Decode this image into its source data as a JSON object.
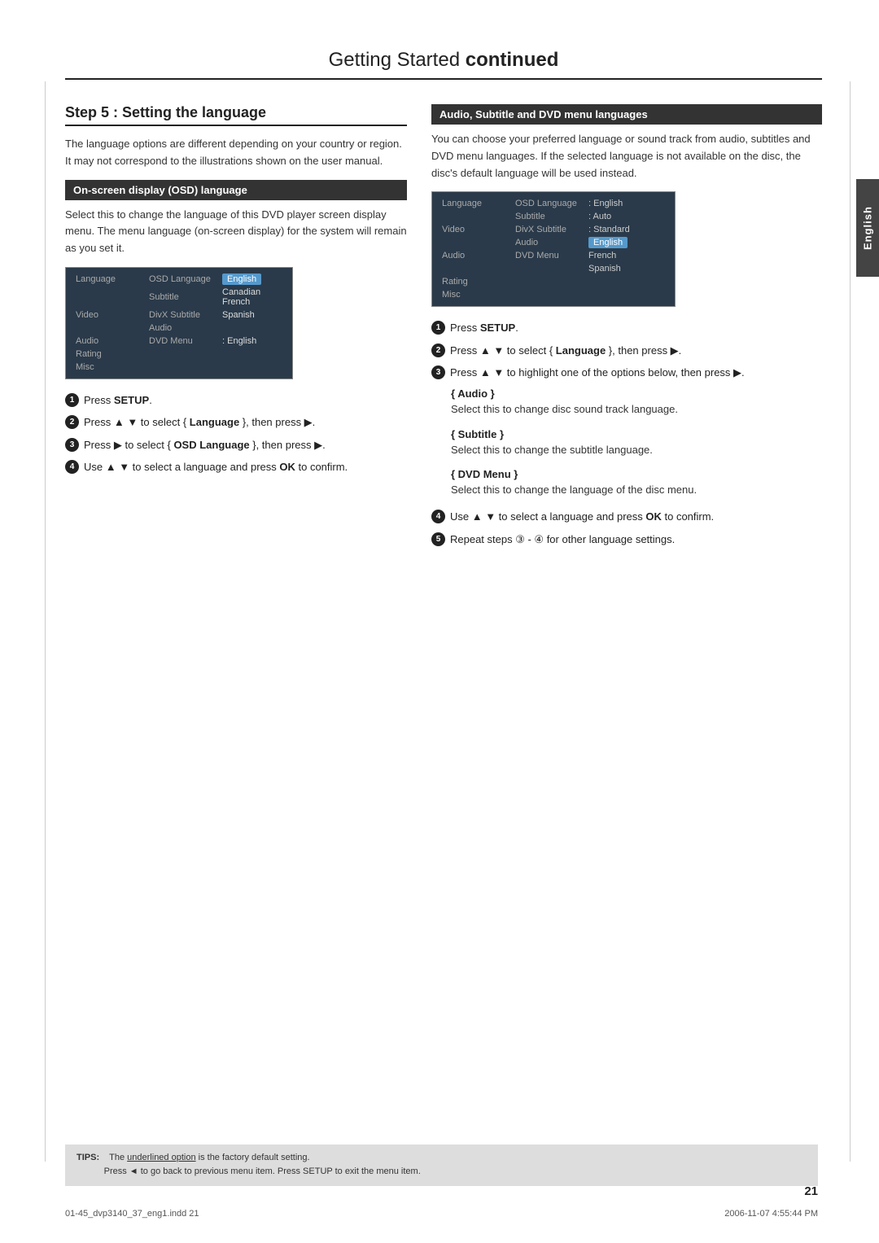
{
  "page": {
    "title_normal": "Getting Started",
    "title_bold": "continued",
    "page_number": "21",
    "footer_left": "01-45_dvp3140_37_eng1.indd  21",
    "footer_right": "2006-11-07  4:55:44 PM",
    "english_tab": "English"
  },
  "step5": {
    "heading": "Step 5 : Setting the language",
    "body1": "The language options are different depending on your country or region. It may not correspond to the illustrations shown on the user manual.",
    "osd_section_heading": "On-screen display (OSD) language",
    "osd_body": "Select this to change the language of this DVD player screen display menu. The menu language (on-screen display) for the system will remain as you set it.",
    "osd_menu": {
      "rows": [
        {
          "label": "Language",
          "key": "OSD Language",
          "value": "English",
          "highlight": true
        },
        {
          "label": "",
          "key": "Subtitle",
          "value": "Canadian French",
          "highlight": false
        },
        {
          "label": "Video",
          "key": "DivX Subtitle",
          "value": "Spanish",
          "highlight": false
        },
        {
          "label": "",
          "key": "Audio",
          "value": "",
          "highlight": false
        },
        {
          "label": "Audio",
          "key": "DVD Menu",
          "value": ": English",
          "highlight": false
        },
        {
          "label": "",
          "key": "",
          "value": "",
          "highlight": false
        },
        {
          "label": "Rating",
          "key": "",
          "value": "",
          "highlight": false
        },
        {
          "label": "",
          "key": "",
          "value": "",
          "highlight": false
        },
        {
          "label": "Misc",
          "key": "",
          "value": "",
          "highlight": false
        }
      ]
    },
    "steps": [
      {
        "num": "1",
        "text": "Press ",
        "bold": "SETUP",
        "rest": "."
      },
      {
        "num": "2",
        "text": "Press ▲ ▼ to select { ",
        "bold": "Language",
        "rest": " }, then press ▶."
      },
      {
        "num": "3",
        "text": "Press ▶ to select { ",
        "bold": "OSD Language",
        "rest": " }, then press ▶."
      },
      {
        "num": "4",
        "text": "Use ▲ ▼ to select a language and press ",
        "bold": "OK",
        "rest": " to confirm."
      }
    ]
  },
  "audio_section": {
    "heading": "Audio, Subtitle and DVD menu languages",
    "body": "You can choose your preferred language or sound track from audio, subtitles and DVD menu languages. If the selected language is not available on the disc, the disc's default language will be used instead.",
    "menu": {
      "rows": [
        {
          "label": "Language",
          "key": "OSD Language",
          "value": ": English"
        },
        {
          "label": "",
          "key": "Subtitle",
          "value": ": Auto"
        },
        {
          "label": "Video",
          "key": "DivX Subtitle",
          "value": ": Standard",
          "highlight_value": false
        },
        {
          "label": "",
          "key": "Audio",
          "value": "English",
          "highlight_value": true
        },
        {
          "label": "Audio",
          "key": "DVD Menu",
          "value": "French",
          "highlight_value": false
        },
        {
          "label": "",
          "key": "",
          "value": "Spanish",
          "highlight_value": false
        },
        {
          "label": "Rating",
          "key": "",
          "value": ""
        },
        {
          "label": "",
          "key": "",
          "value": ""
        },
        {
          "label": "Misc",
          "key": "",
          "value": ""
        }
      ]
    },
    "steps": [
      {
        "num": "1",
        "text": "Press ",
        "bold": "SETUP",
        "rest": "."
      },
      {
        "num": "2",
        "text": "Press ▲ ▼ to select { ",
        "bold": "Language",
        "rest": " }, then press ▶."
      },
      {
        "num": "3",
        "text": "Press ▲ ▼ to highlight one of the options below, then press ▶."
      },
      {
        "sub_label": "{ Audio }",
        "sub_body": "Select this to change disc sound track language."
      },
      {
        "sub_label": "{ Subtitle }",
        "sub_body": "Select this to change the subtitle language."
      },
      {
        "sub_label": "{ DVD Menu }",
        "sub_body": "Select this to change the language of the disc menu."
      },
      {
        "num": "4",
        "text": "Use ▲ ▼ to select a language and press ",
        "bold": "OK",
        "rest": " to confirm."
      },
      {
        "num": "5",
        "text": "Repeat steps ③ - ④ for other language settings."
      }
    ]
  },
  "tips": {
    "label": "TIPS:",
    "line1": "The underlined option is the factory default setting.",
    "line2": "Press ◄ to go back to previous menu item. Press SETUP to exit the menu item."
  }
}
